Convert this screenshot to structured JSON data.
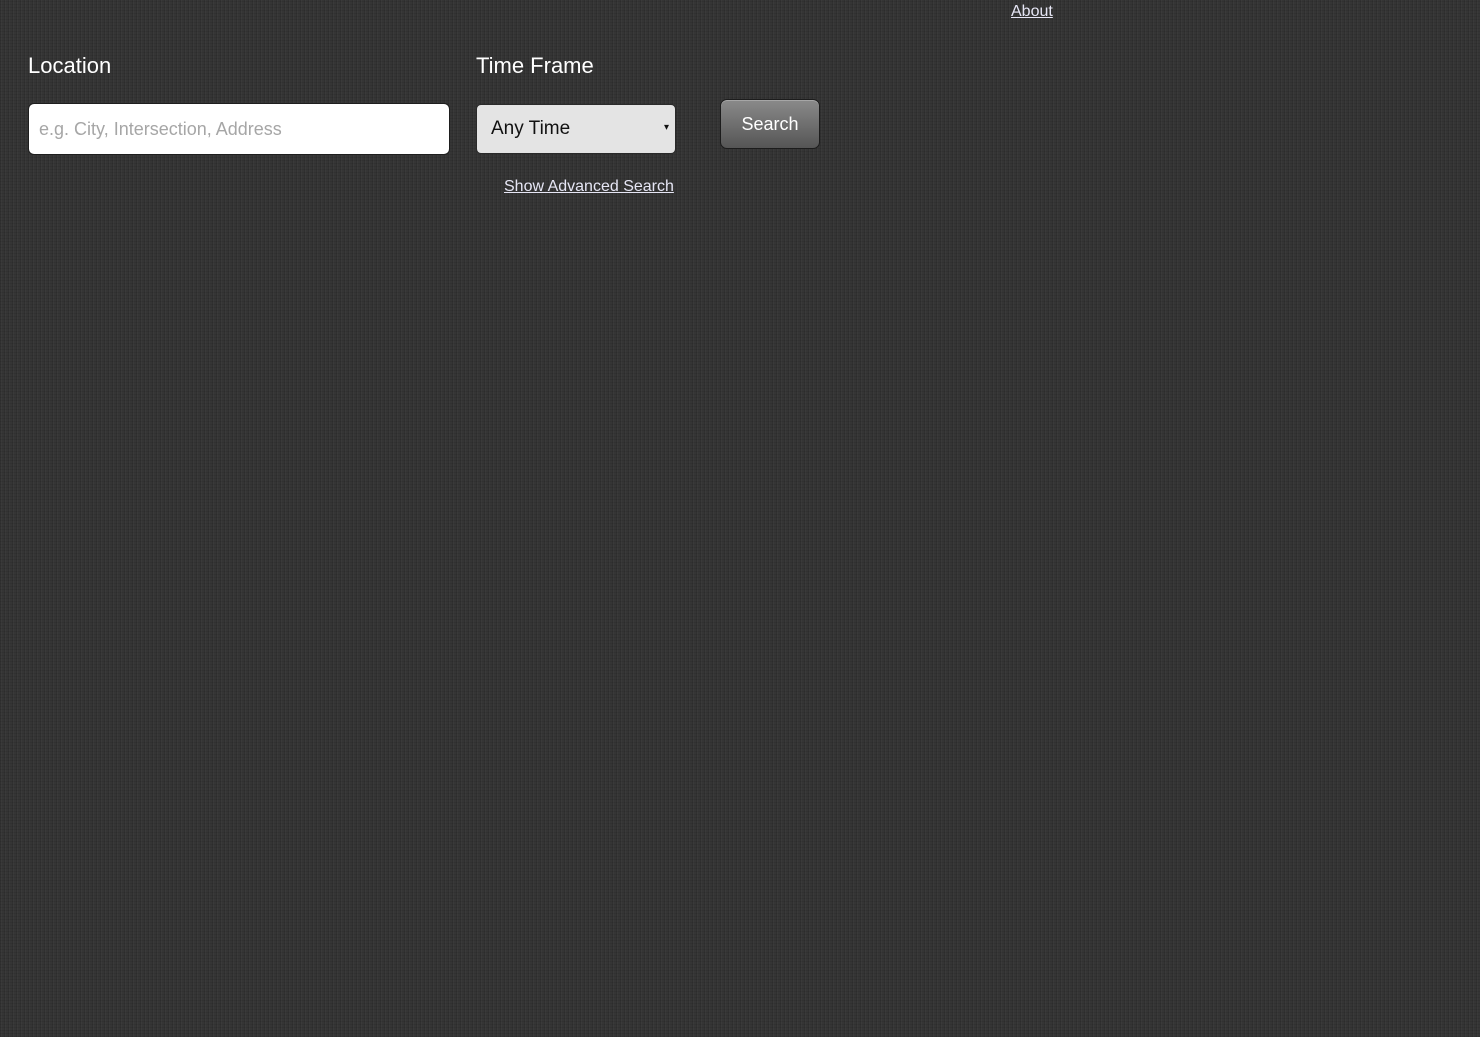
{
  "header": {
    "about_label": "About"
  },
  "search_form": {
    "location": {
      "label": "Location",
      "placeholder": "e.g. City, Intersection, Address",
      "value": ""
    },
    "time_frame": {
      "label": "Time Frame",
      "selected": "Any Time",
      "chevron": "▾"
    },
    "search_button_label": "Search",
    "advanced_link_label": "Show Advanced Search"
  },
  "colors": {
    "background": "#353535",
    "link": "#e6e6f5",
    "button": "#6e6e6e"
  }
}
